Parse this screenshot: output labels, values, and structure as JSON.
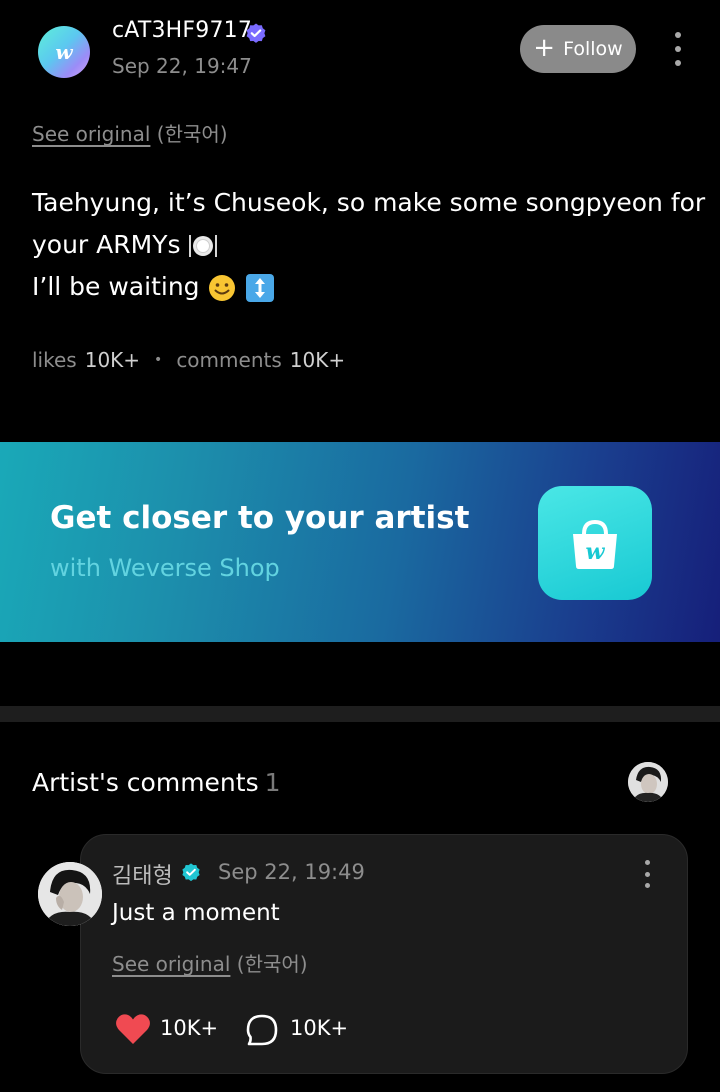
{
  "post": {
    "author": "cAT3HF9717",
    "date": "Sep 22, 19:47",
    "follow_label": "Follow",
    "see_original_link": "See original",
    "see_original_lang": "(한국어)",
    "body_line1": "Taehyung, it’s Chuseok, so make some songpyeon for",
    "body_line2": "your ARMYs",
    "body_line3": "I’ll be waiting",
    "likes_label": "likes",
    "likes_value": "10K+",
    "comments_label": "comments",
    "comments_value": "10K+"
  },
  "banner": {
    "title": "Get closer to your artist",
    "subtitle": "with Weverse Shop"
  },
  "artist_comments": {
    "title": "Artist's comments",
    "count": "1",
    "comment": {
      "author": "김태형",
      "date": "Sep 22, 19:49",
      "text": "Just a moment",
      "see_original_link": "See original",
      "see_original_lang": "(한국어)",
      "likes": "10K+",
      "replies": "10K+"
    }
  },
  "icons": {
    "avatar": "weverse-logo-icon",
    "verified": "verified-badge-icon",
    "more": "more-vertical-icon",
    "plus": "plus-icon",
    "plate": "plate-cutlery-emoji",
    "smile": "smiling-face-emoji",
    "updown": "up-down-arrow-emoji",
    "shop": "shopping-bag-icon",
    "heart": "heart-icon",
    "comment": "comment-bubble-icon"
  },
  "colors": {
    "background": "#000000",
    "follow_button": "#8a8a8a",
    "banner_start": "#1aa9b8",
    "banner_end": "#161f7a",
    "banner_subtitle": "#62d3e0",
    "heart": "#f04a52",
    "verified_post": "#7a6bff",
    "verified_comment": "#20c6d2"
  }
}
